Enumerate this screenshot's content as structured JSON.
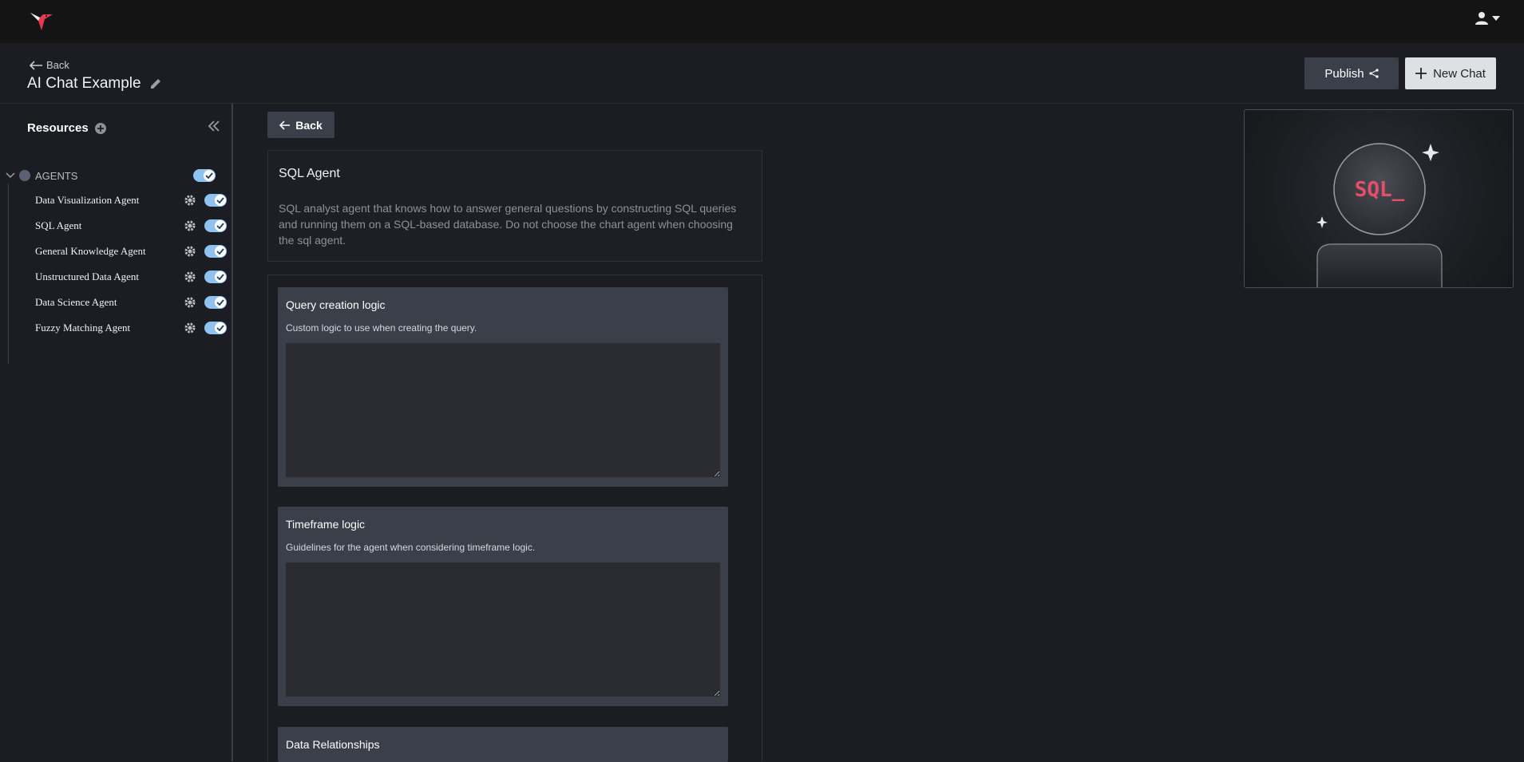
{
  "header": {
    "back_label": "Back",
    "chat_title": "AI Chat Example",
    "publish_label": "Publish",
    "new_chat_label": "New Chat"
  },
  "sidebar": {
    "title": "Resources",
    "group_label": "AGENTS",
    "agents": [
      {
        "label": "Data Visualization Agent"
      },
      {
        "label": "SQL Agent"
      },
      {
        "label": "General Knowledge Agent"
      },
      {
        "label": "Unstructured Data Agent"
      },
      {
        "label": "Data Science Agent"
      },
      {
        "label": "Fuzzy Matching Agent"
      }
    ]
  },
  "main": {
    "back_label": "Back",
    "agent_name": "SQL Agent",
    "agent_description": "SQL analyst agent that knows how to answer general questions by constructing SQL queries and running them on a SQL-based database. Do not choose the chart agent when choosing the sql agent.",
    "settings": [
      {
        "title": "Query creation logic",
        "description": "Custom logic to use when creating the query.",
        "value": ""
      },
      {
        "title": "Timeframe logic",
        "description": "Guidelines for the agent when considering timeframe logic.",
        "value": ""
      },
      {
        "title": "Data Relationships"
      }
    ]
  },
  "avatar": {
    "badge_text": "SQL_"
  },
  "colors": {
    "accent_toggle": "#8ec3f0",
    "sql_text": "#e84d6a",
    "logo_red": "#e8384f"
  }
}
